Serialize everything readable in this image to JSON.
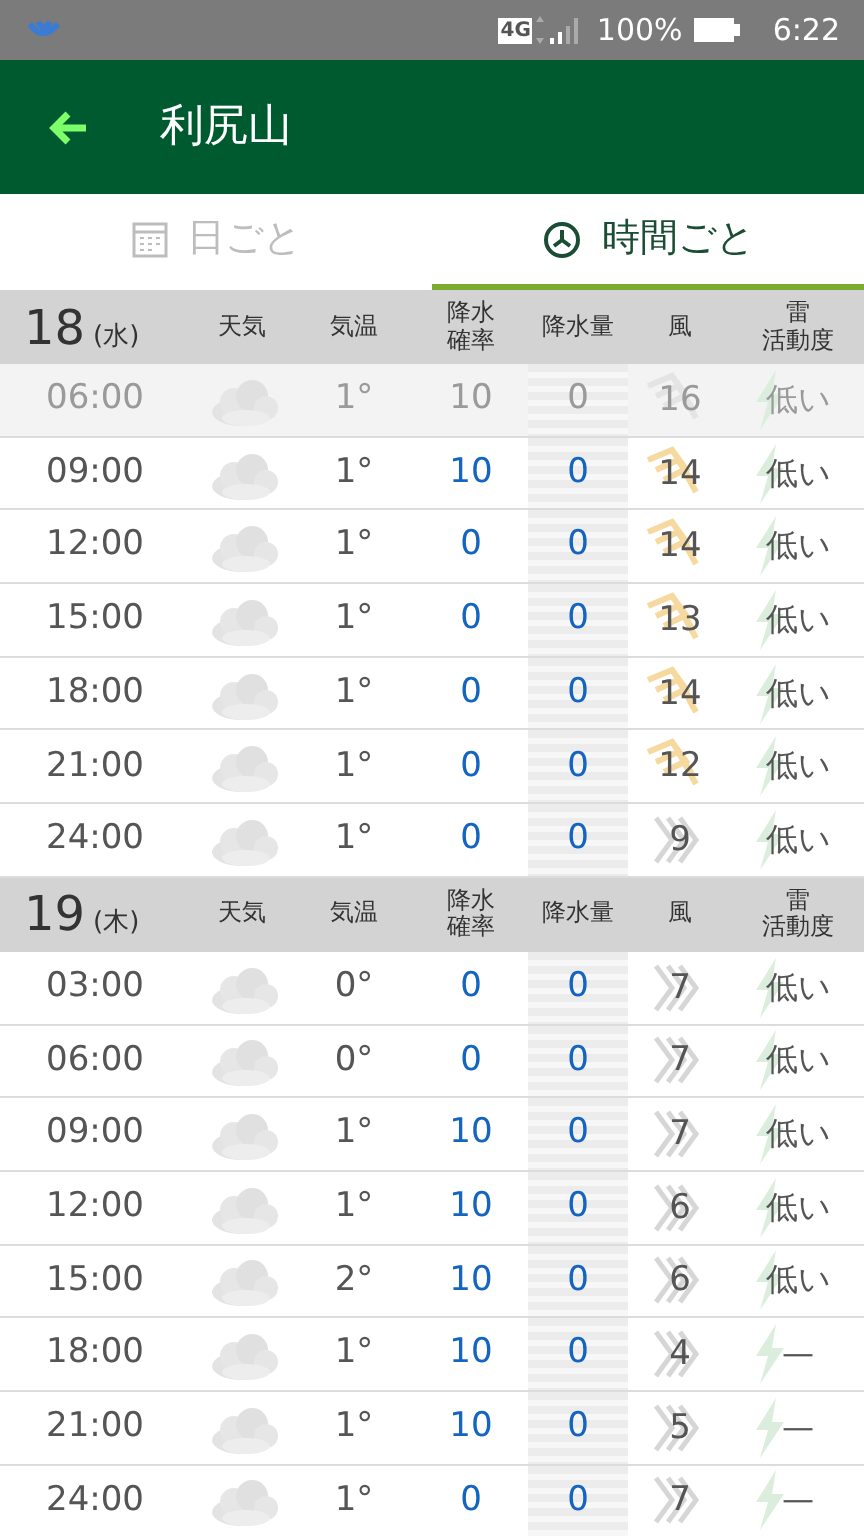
{
  "status_bar": {
    "network": "4G",
    "battery": "100%",
    "time": "6:22"
  },
  "app_bar": {
    "title": "利尻山"
  },
  "tabs": [
    {
      "label": "日ごと",
      "kind": "calendar",
      "selected": false
    },
    {
      "label": "時間ごと",
      "kind": "clock",
      "selected": true
    }
  ],
  "days": [
    {
      "day": "18",
      "weekday": "(水)",
      "columns": [
        [
          "天気"
        ],
        [
          "気温"
        ],
        [
          "降水",
          "確率"
        ],
        [
          "降水量"
        ],
        [
          "風"
        ],
        [
          "雷",
          "活動度"
        ]
      ],
      "rows": [
        {
          "time": "06:00",
          "past": true,
          "temp": "1°",
          "precip_prob": "10",
          "precip_amount": "0",
          "wind": "16",
          "wind_strong": true,
          "thunder": "低い"
        },
        {
          "time": "09:00",
          "past": false,
          "temp": "1°",
          "precip_prob": "10",
          "precip_amount": "0",
          "wind": "14",
          "wind_strong": true,
          "thunder": "低い"
        },
        {
          "time": "12:00",
          "past": false,
          "temp": "1°",
          "precip_prob": "0",
          "precip_amount": "0",
          "wind": "14",
          "wind_strong": true,
          "thunder": "低い"
        },
        {
          "time": "15:00",
          "past": false,
          "temp": "1°",
          "precip_prob": "0",
          "precip_amount": "0",
          "wind": "13",
          "wind_strong": true,
          "thunder": "低い"
        },
        {
          "time": "18:00",
          "past": false,
          "temp": "1°",
          "precip_prob": "0",
          "precip_amount": "0",
          "wind": "14",
          "wind_strong": true,
          "thunder": "低い"
        },
        {
          "time": "21:00",
          "past": false,
          "temp": "1°",
          "precip_prob": "0",
          "precip_amount": "0",
          "wind": "12",
          "wind_strong": true,
          "thunder": "低い"
        },
        {
          "time": "24:00",
          "past": false,
          "temp": "1°",
          "precip_prob": "0",
          "precip_amount": "0",
          "wind": "9",
          "wind_strong": false,
          "thunder": "低い"
        }
      ]
    },
    {
      "day": "19",
      "weekday": "(木)",
      "columns": [
        [
          "天気"
        ],
        [
          "気温"
        ],
        [
          "降水",
          "確率"
        ],
        [
          "降水量"
        ],
        [
          "風"
        ],
        [
          "雷",
          "活動度"
        ]
      ],
      "rows": [
        {
          "time": "03:00",
          "past": false,
          "temp": "0°",
          "precip_prob": "0",
          "precip_amount": "0",
          "wind": "7",
          "wind_strong": false,
          "thunder": "低い"
        },
        {
          "time": "06:00",
          "past": false,
          "temp": "0°",
          "precip_prob": "0",
          "precip_amount": "0",
          "wind": "7",
          "wind_strong": false,
          "thunder": "低い"
        },
        {
          "time": "09:00",
          "past": false,
          "temp": "1°",
          "precip_prob": "10",
          "precip_amount": "0",
          "wind": "7",
          "wind_strong": false,
          "thunder": "低い"
        },
        {
          "time": "12:00",
          "past": false,
          "temp": "1°",
          "precip_prob": "10",
          "precip_amount": "0",
          "wind": "6",
          "wind_strong": false,
          "thunder": "低い"
        },
        {
          "time": "15:00",
          "past": false,
          "temp": "2°",
          "precip_prob": "10",
          "precip_amount": "0",
          "wind": "6",
          "wind_strong": false,
          "thunder": "低い"
        },
        {
          "time": "18:00",
          "past": false,
          "temp": "1°",
          "precip_prob": "10",
          "precip_amount": "0",
          "wind": "4",
          "wind_strong": false,
          "thunder": "—"
        },
        {
          "time": "21:00",
          "past": false,
          "temp": "1°",
          "precip_prob": "10",
          "precip_amount": "0",
          "wind": "5",
          "wind_strong": false,
          "thunder": "—"
        },
        {
          "time": "24:00",
          "past": false,
          "temp": "1°",
          "precip_prob": "0",
          "precip_amount": "0",
          "wind": "7",
          "wind_strong": false,
          "thunder": "—"
        }
      ]
    }
  ]
}
